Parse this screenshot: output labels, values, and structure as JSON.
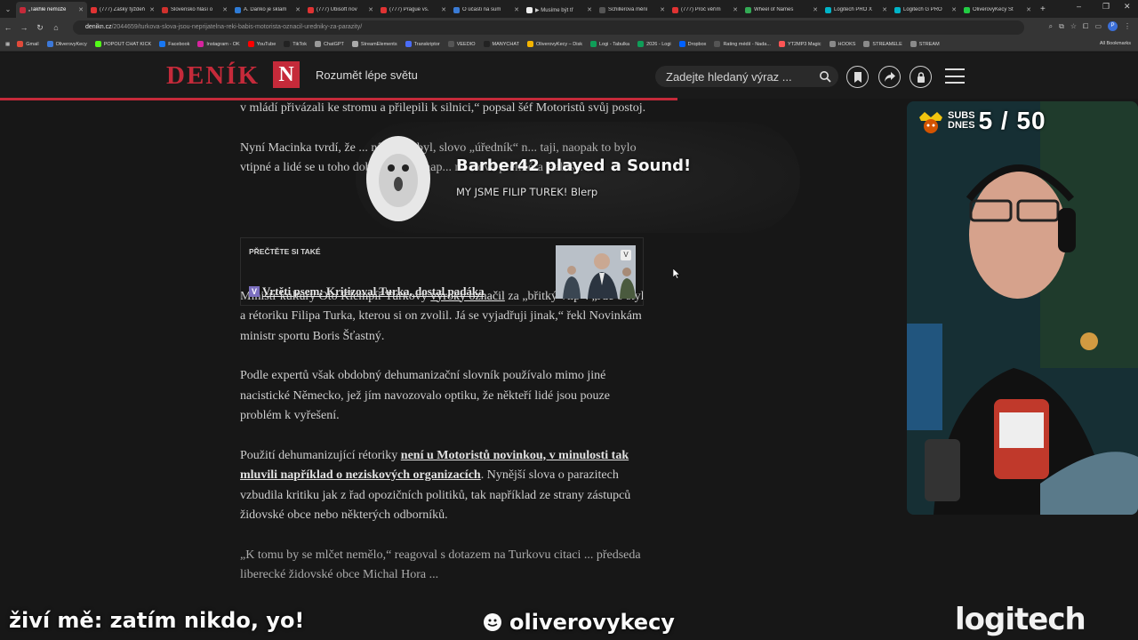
{
  "browser": {
    "tabs": [
      {
        "label": "„Takhle nemůže",
        "color": "#c52a3a",
        "active": true
      },
      {
        "label": "(777) Žašký týždeň",
        "color": "#e03333",
        "active": false
      },
      {
        "label": "Slovensko hlásí o",
        "color": "#d0312d",
        "active": false
      },
      {
        "label": "A. Danko je sklam",
        "color": "#2e7bd6",
        "active": false
      },
      {
        "label": "(777) Ubisoft nov",
        "color": "#e03333",
        "active": false
      },
      {
        "label": "(777) Prague vs.",
        "color": "#e03333",
        "active": false
      },
      {
        "label": "O účasti na sum",
        "color": "#3a7bd5",
        "active": false
      },
      {
        "label": "▶ Musíme být tř",
        "color": "#eeeeee",
        "active": false
      },
      {
        "label": "Schillerová mění",
        "color": "#555555",
        "active": false
      },
      {
        "label": "(777) Proč věřím",
        "color": "#e03333",
        "active": false
      },
      {
        "label": "Wheel of Names",
        "color": "#33aa55",
        "active": false
      },
      {
        "label": "Logitech PRO X",
        "color": "#00b4c8",
        "active": false
      },
      {
        "label": "Logitech G PRO",
        "color": "#00b4c8",
        "active": false
      },
      {
        "label": "OliverovyKecy St",
        "color": "#22cc44",
        "active": false
      }
    ],
    "url_host": "denikn.cz",
    "url_path": "/2044659/turkova-slova-jsou-neprijatelna-reki-babis-motorista-oznacil-uredniky-za-parazity/",
    "bookmarks": [
      {
        "label": "Gmail",
        "color": "#e04a3a"
      },
      {
        "label": "OliverovyKecy",
        "color": "#3c78d8"
      },
      {
        "label": "POPOUT CHAT KICK",
        "color": "#53fc18"
      },
      {
        "label": "Facebook",
        "color": "#1877f2"
      },
      {
        "label": "Instagram - OK",
        "color": "#d6249f"
      },
      {
        "label": "YouTube",
        "color": "#ff0000"
      },
      {
        "label": "TikTok",
        "color": "#222222"
      },
      {
        "label": "ChatGPT",
        "color": "#9a9a9a"
      },
      {
        "label": "StreamElements",
        "color": "#aaaaaa"
      },
      {
        "label": "Transkriptor",
        "color": "#4a6cf7"
      },
      {
        "label": "VEEDIO",
        "color": "#555555"
      },
      {
        "label": "MANYCHAT",
        "color": "#222222"
      },
      {
        "label": "OliverovyKecy – Disk",
        "color": "#f4b400"
      },
      {
        "label": "Logi - Tabulka",
        "color": "#0f9d58"
      },
      {
        "label": "2026 - Logi",
        "color": "#0f9d58"
      },
      {
        "label": "Dropbox",
        "color": "#0061ff"
      },
      {
        "label": "Rating médií - Nada...",
        "color": "#555555"
      },
      {
        "label": "YT2MP3 Magic",
        "color": "#ff5555"
      },
      {
        "label": "HOOKS",
        "color": "#8a8a8a"
      },
      {
        "label": "STREAMELE",
        "color": "#8a8a8a"
      },
      {
        "label": "STREAM",
        "color": "#8a8a8a"
      }
    ],
    "all_bookmarks": "All Bookmarks"
  },
  "site": {
    "logo_text": "DENÍK",
    "logo_letter": "N",
    "tagline": "Rozumět lépe světu",
    "search_placeholder": "Zadejte hledaný výraz ...",
    "accent": "#c52a3a"
  },
  "article": {
    "p1": "v mládí přivázali ke stromu a přilepili k silnici,“ popsal šéf Motoristů svůj postoj.",
    "p2": "Nyní Macinka tvrdí, že ... nících ... byl, slovo „úředník“ n... taji, naopak to bylo vtipné a lidé se u toho dobře bavili,“ nap... na slova premiéra Babiše.",
    "read_also_label": "PŘEČTĚTE SI TAKÉ",
    "read_also_icon": "V",
    "read_also_title": "Vrtěti psem: Kritizoval Turka, dostal padáka",
    "p3_a": "Ministr kultury Oto Klempíř Turkovy ",
    "p3_link": "výroky označil",
    "p3_b": " za „břitký vtip“. „Jde o styl a rétoriku Filipa Turka, kterou si on zvolil. Já se vyjadřuji jinak,“ řekl Novinkám ministr sportu Boris Šťastný.",
    "p4": "Podle expertů však obdobný dehumanizační slovník používalo mimo jiné nacistické Německo, jež jím navozovalo optiku, že někteří lidé jsou pouze problém k vyřešení.",
    "p5_a": "Použití dehumanizující rétoriky ",
    "p5_link": "není u Motoristů novinkou, v minulosti tak mluvili například o neziskových organizacích",
    "p5_b": ". Nynější slova o parazitech vzbudila kritiku jak z řad opozičních politiků, tak například ze strany zástupců židovské obce nebo některých odborníků.",
    "p6": "„K tomu by se mlčet nemělo,“ reagoval s dotazem na Turkovu citaci ... předseda liberecké židovské obce Michal Hora ... "
  },
  "alert": {
    "title": "Barber42 played a Sound!",
    "message": "MY JSME FILIP TUREK! Blerp"
  },
  "stream": {
    "subs_label_1": "SUBS",
    "subs_label_2": "DNES",
    "subs_count": "5 / 50",
    "ticker": "živí mě: zatím nikdo, yo!",
    "channel": "oliverovykecy",
    "sponsor": "logitech"
  }
}
